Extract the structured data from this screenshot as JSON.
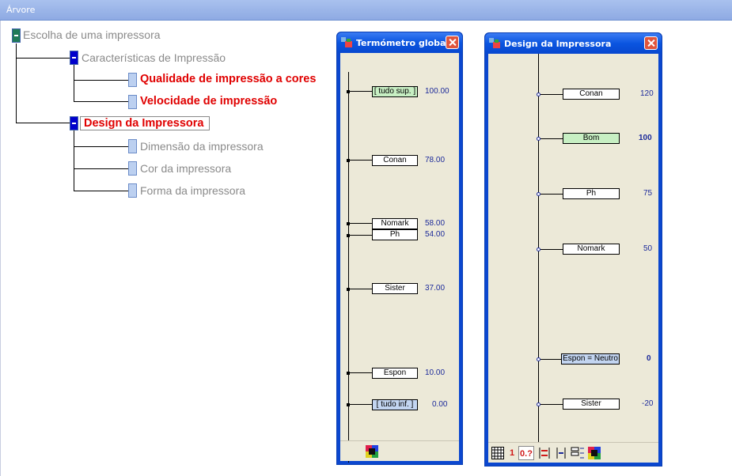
{
  "main_window": {
    "title": "Árvore"
  },
  "tree": {
    "root": {
      "label": "Escolha de uma impressora"
    },
    "characteristics": {
      "label": "Características de Impressão"
    },
    "quality": {
      "label": "Qualidade de impressão a cores"
    },
    "speed": {
      "label": "Velocidade de impressão"
    },
    "design": {
      "label": "Design da Impressora"
    },
    "dimension": {
      "label": "Dimensão da impressora"
    },
    "color": {
      "label": "Cor da impressora"
    },
    "shape": {
      "label": "Forma da impressora"
    }
  },
  "thermometer": {
    "title": "Termómetro global",
    "items": [
      {
        "label": "[ tudo sup. ]",
        "value": "100.00",
        "style": "green"
      },
      {
        "label": "Conan",
        "value": "78.00",
        "style": "plain"
      },
      {
        "label": "Nomark",
        "value": "58.00",
        "style": "plain"
      },
      {
        "label": "Ph",
        "value": "54.00",
        "style": "plain"
      },
      {
        "label": "Sister",
        "value": "37.00",
        "style": "plain"
      },
      {
        "label": "Espon",
        "value": "10.00",
        "style": "plain"
      },
      {
        "label": "[ tudo inf. ]",
        "value": "0.00",
        "style": "blue"
      }
    ]
  },
  "design_window": {
    "title": "Design da Impressora",
    "items": [
      {
        "label": "Conan",
        "value": "120",
        "style": "plain",
        "bold": false
      },
      {
        "label": "Bom",
        "value": "100",
        "style": "green",
        "bold": true
      },
      {
        "label": "Ph",
        "value": "75",
        "style": "plain",
        "bold": false
      },
      {
        "label": "Nomark",
        "value": "50",
        "style": "plain",
        "bold": false
      },
      {
        "label": "Espon = Neutro",
        "value": "0",
        "style": "blue",
        "bold": true
      },
      {
        "label": "Sister",
        "value": "-20",
        "style": "plain",
        "bold": false
      }
    ],
    "toolbar": {
      "one": "1",
      "zero_q": "0.?"
    }
  },
  "colors": {
    "accent": "#0a55e0",
    "red_text": "#e00000",
    "value_blue": "#1c2a9a"
  }
}
